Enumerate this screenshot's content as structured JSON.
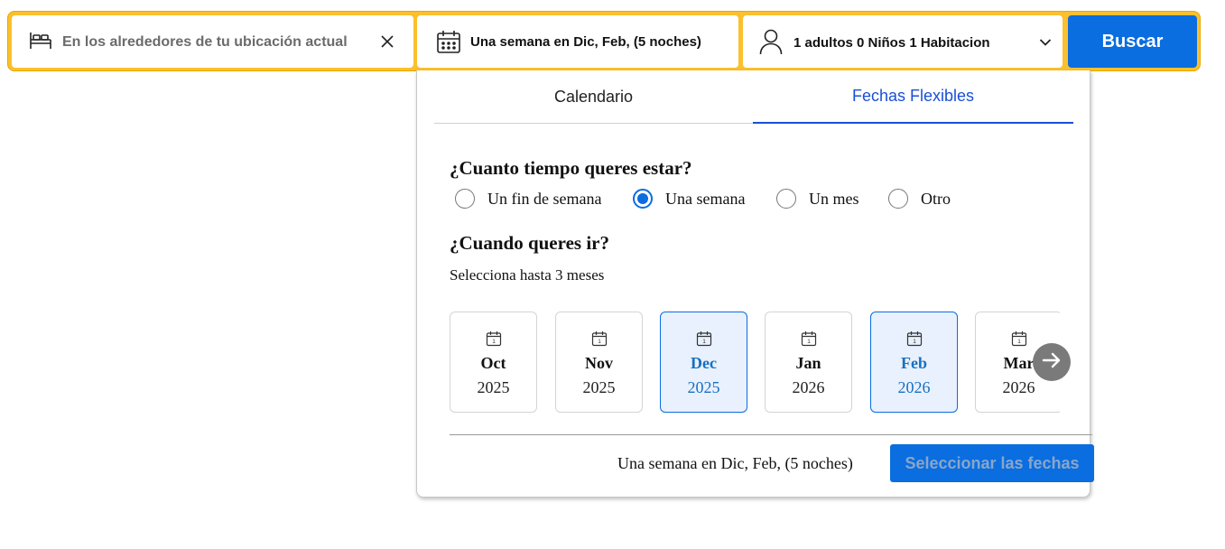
{
  "search": {
    "destination": "En los alrededores de tu ubicación actual",
    "dates": "Una semana en Dic, Feb, (5 noches)",
    "guests": "1 adultos 0 Niños 1 Habitacion",
    "button": "Buscar",
    "icons": {
      "destination": "bed-icon",
      "clear": "close-icon",
      "dates": "calendar-icon",
      "guests": "person-icon",
      "guests_toggle": "chevron-down-icon"
    }
  },
  "panel": {
    "tabs": [
      {
        "label": "Calendario",
        "active": false
      },
      {
        "label": "Fechas Flexibles",
        "active": true
      }
    ],
    "duration_question": "¿Cuanto tiempo queres estar?",
    "duration_options": [
      {
        "label": "Un fin de semana",
        "selected": false
      },
      {
        "label": "Una semana",
        "selected": true
      },
      {
        "label": "Un mes",
        "selected": false
      },
      {
        "label": "Otro",
        "selected": false
      }
    ],
    "when_question": "¿Cuando queres ir?",
    "when_hint": "Selecciona hasta 3 meses",
    "months": [
      {
        "name": "Oct",
        "year": "2025",
        "selected": false,
        "icon_day": "1"
      },
      {
        "name": "Nov",
        "year": "2025",
        "selected": false,
        "icon_day": "1"
      },
      {
        "name": "Dec",
        "year": "2025",
        "selected": true,
        "icon_day": "1"
      },
      {
        "name": "Jan",
        "year": "2026",
        "selected": false,
        "icon_day": "1"
      },
      {
        "name": "Feb",
        "year": "2026",
        "selected": true,
        "icon_day": "1"
      },
      {
        "name": "Mar",
        "year": "2026",
        "selected": false,
        "icon_day": "1"
      }
    ],
    "next_icon": "arrow-right-icon",
    "summary": "Una semana en Dic, Feb, (5 noches)",
    "confirm_button": "Seleccionar las fechas"
  },
  "colors": {
    "searchbar_border": "#fbc02d",
    "primary": "#0a6de0",
    "tab_active": "#1a4fd6",
    "month_selected_bg": "#e8f1fd",
    "month_selected_text": "#1a6fc0"
  }
}
